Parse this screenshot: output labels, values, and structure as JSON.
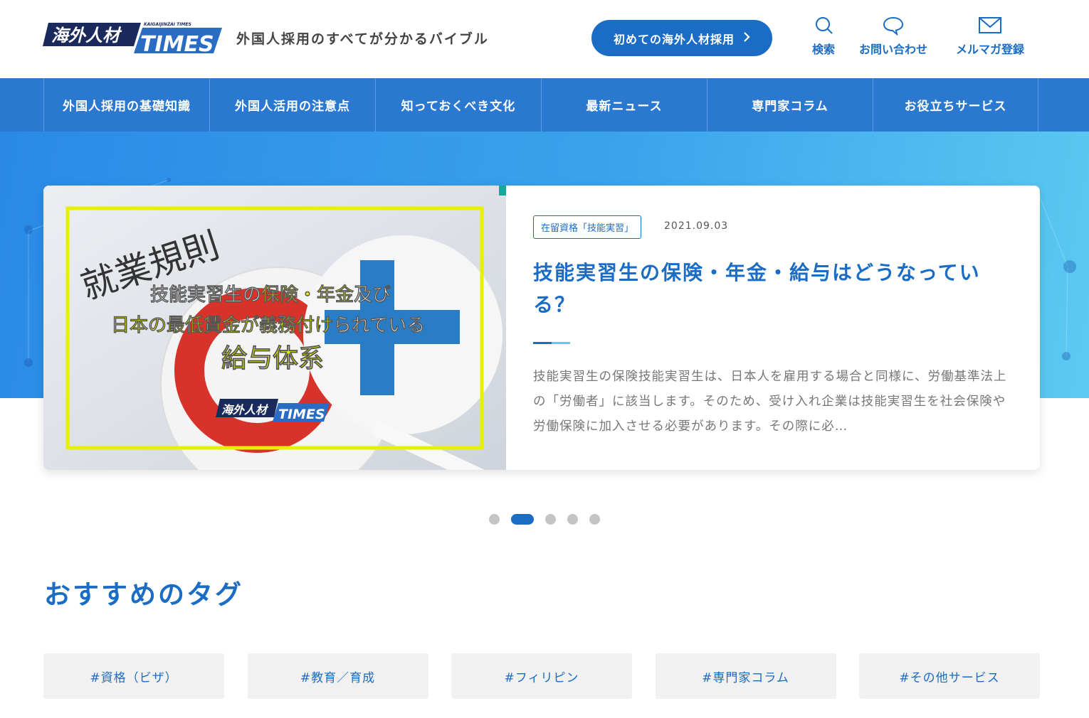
{
  "header": {
    "logo_main": "海外人材",
    "logo_times": "TIMES",
    "logo_sub": "KAIGAIJINZAI TIMES",
    "tagline": "外国人採用のすべてが分かるバイブル",
    "cta_label": "初めての海外人材採用",
    "icons": [
      {
        "label": "検索",
        "icon": "search-icon"
      },
      {
        "label": "お問い合わせ",
        "icon": "speech-bubble-icon"
      },
      {
        "label": "メルマガ登録",
        "icon": "mail-icon"
      }
    ]
  },
  "nav": {
    "items": [
      "外国人採用の基礎知識",
      "外国人活用の注意点",
      "知っておくべき文化",
      "最新ニュース",
      "専門家コラム",
      "お役立ちサービス"
    ]
  },
  "hero": {
    "image_heading": "就業規則",
    "image_line1_white": "技能実習生の",
    "image_line1_yellow": "保険・年金",
    "image_line1_tail": "及び",
    "image_line2_yellow": "日本の最低賃金が義務付け",
    "image_line2_tail": "られている",
    "image_line3": "給与体系",
    "image_logo_main": "海外人材",
    "image_logo_times": "TIMES",
    "category": "在留資格「技能実習」",
    "date": "2021.09.03",
    "title": "技能実習生の保険・年金・給与はどうなっている？",
    "excerpt": "技能実習生の保険技能実習生は、日本人を雇用する場合と同様に、労働基準法上の「労働者」に該当します。そのため、受け入れ企業は技能実習生を社会保険や労働保険に加入させる必要があります。その際に必…"
  },
  "carousel": {
    "count": 5,
    "active": 1
  },
  "tags_section": {
    "title": "おすすめのタグ",
    "tags": [
      "#資格（ビザ）",
      "#教育／育成",
      "#フィリピン",
      "#専門家コラム",
      "#その他サービス"
    ]
  },
  "colors": {
    "brand": "#1a6cc4",
    "nav": "#2a78d0",
    "accent_yellow": "#e6f000"
  }
}
